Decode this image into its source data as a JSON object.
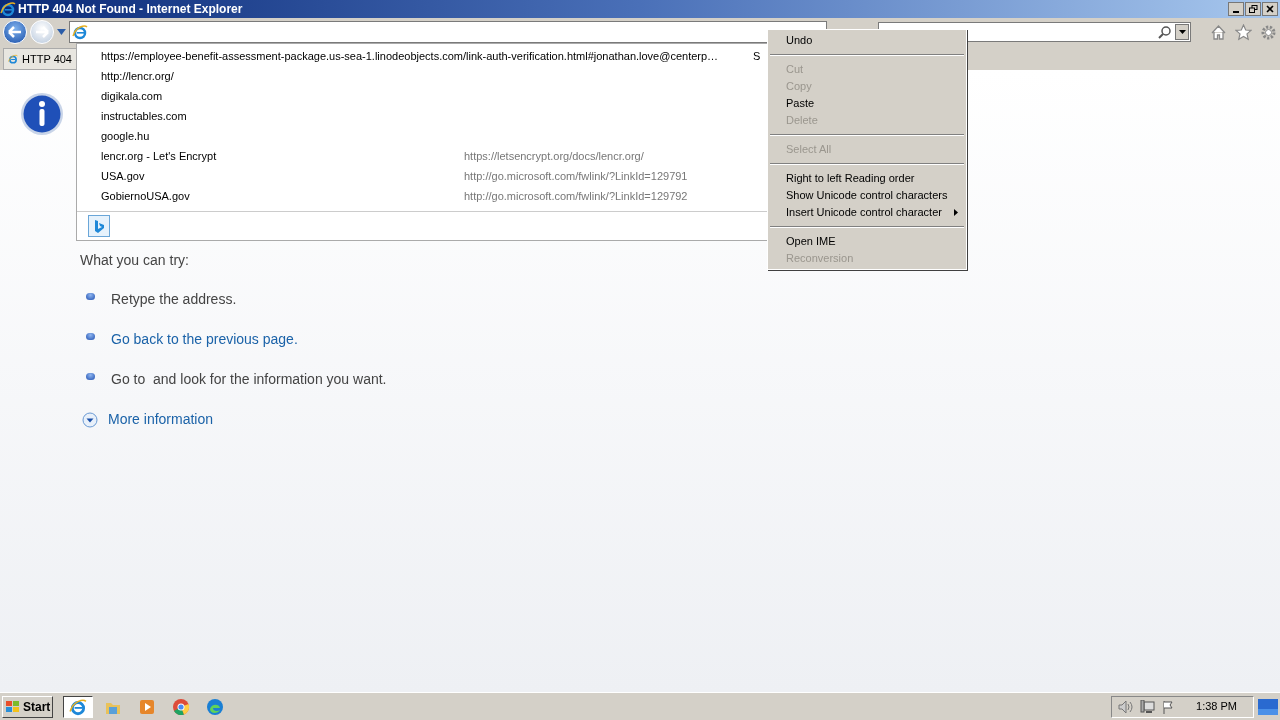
{
  "window": {
    "title": "HTTP 404 Not Found - Internet Explorer"
  },
  "tab": {
    "label": "HTTP 404"
  },
  "suggestions": [
    {
      "title": "https://employee-benefit-assessment-package.us-sea-1.linodeobjects.com/link-auth-verification.html#jonathan.love@centerp…",
      "tail": "S"
    },
    {
      "title": "http://lencr.org/"
    },
    {
      "title": "digikala.com"
    },
    {
      "title": "instructables.com"
    },
    {
      "title": "google.hu"
    },
    {
      "title": "lencr.org - Let's Encrypt",
      "url": "https://letsencrypt.org/docs/lencr.org/"
    },
    {
      "title": "USA.gov",
      "url": "http://go.microsoft.com/fwlink/?LinkId=129791"
    },
    {
      "title": "GobiernoUSA.gov",
      "url": "http://go.microsoft.com/fwlink/?LinkId=129792"
    }
  ],
  "page": {
    "intro": "What you can try:",
    "items": [
      {
        "text": "Retype the address.",
        "kind": "text"
      },
      {
        "text": "Go back to the previous page.",
        "kind": "link"
      },
      {
        "text": "Go to  and look for the information you want.",
        "kind": "text"
      }
    ],
    "more": "More information"
  },
  "context_menu": [
    {
      "kind": "item",
      "label": "Undo",
      "disabled": false
    },
    {
      "kind": "separator"
    },
    {
      "kind": "item",
      "label": "Cut",
      "disabled": true
    },
    {
      "kind": "item",
      "label": "Copy",
      "disabled": true
    },
    {
      "kind": "item",
      "label": "Paste",
      "disabled": false
    },
    {
      "kind": "item",
      "label": "Delete",
      "disabled": true
    },
    {
      "kind": "separator"
    },
    {
      "kind": "item",
      "label": "Select All",
      "disabled": true
    },
    {
      "kind": "separator"
    },
    {
      "kind": "item",
      "label": "Right to left Reading order",
      "disabled": false
    },
    {
      "kind": "item",
      "label": "Show Unicode control characters",
      "disabled": false
    },
    {
      "kind": "submenu",
      "label": "Insert Unicode control character",
      "disabled": false
    },
    {
      "kind": "separator"
    },
    {
      "kind": "item",
      "label": "Open IME",
      "disabled": false
    },
    {
      "kind": "item",
      "label": "Reconversion",
      "disabled": true
    }
  ],
  "taskbar": {
    "start": "Start",
    "apps": [
      {
        "kind": "ie",
        "selected": true
      },
      {
        "kind": "explorer",
        "selected": false
      },
      {
        "kind": "media",
        "selected": false
      },
      {
        "kind": "chrome",
        "selected": false
      },
      {
        "kind": "edge",
        "selected": false
      }
    ],
    "clock": "1:38 PM"
  }
}
